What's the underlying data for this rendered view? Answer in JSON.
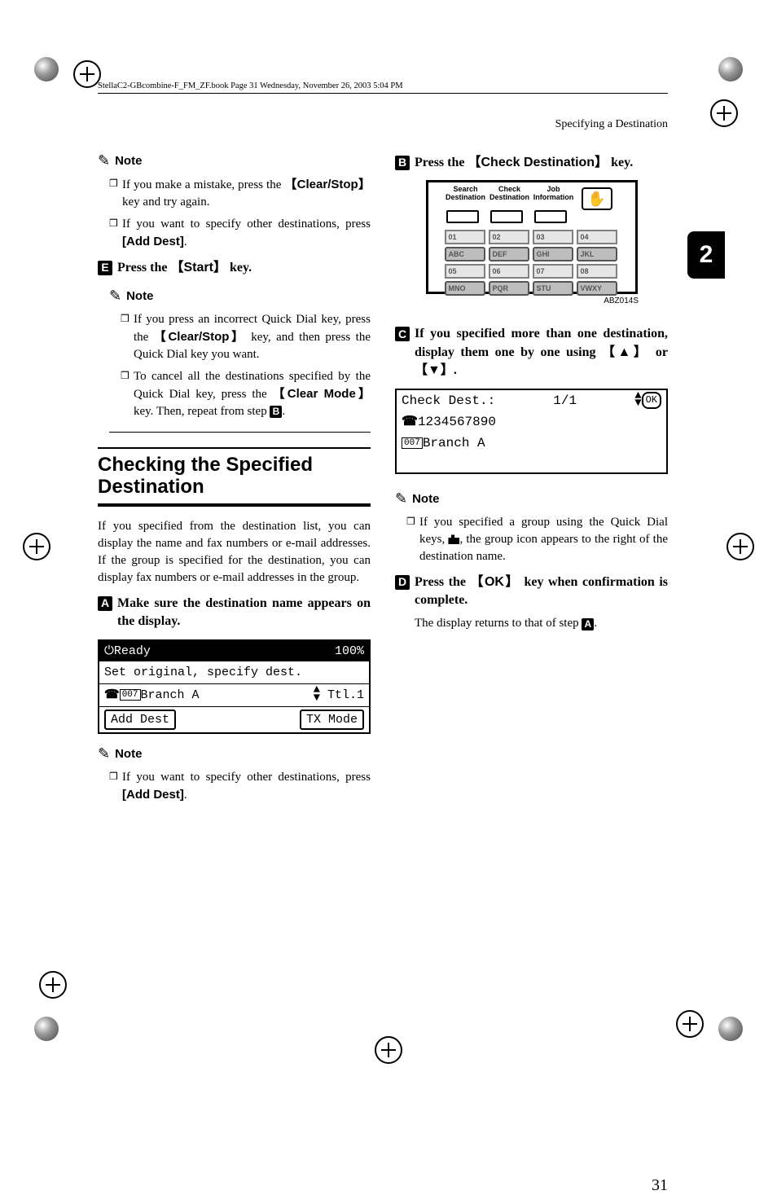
{
  "running_header": "StellaC2-GBcombine-F_FM_ZF.book  Page 31  Wednesday, November 26, 2003  5:04 PM",
  "section_header": "Specifying a Destination",
  "chapter_tab": "2",
  "page_number": "31",
  "left": {
    "note1_label": "Note",
    "note1_items": {
      "a_pre": "If you make a mistake, press the ",
      "a_key": "Clear/Stop",
      "a_post": " key and try again.",
      "b_pre": "If you want to specify other destinations, press ",
      "b_bold": "[Add Dest]",
      "b_post": "."
    },
    "stepE_num": "E",
    "stepE_pre": "Press the ",
    "stepE_key": "Start",
    "stepE_post": " key.",
    "note2_label": "Note",
    "note2_items": {
      "a_pre": "If you press an incorrect Quick Dial key, press the ",
      "a_key": "Clear/Stop",
      "a_post": " key, and then press the Quick Dial key you want.",
      "b_pre": "To cancel all the destinations specified by the Quick Dial key, press the ",
      "b_key": "Clear Mode",
      "b_post1": " key. Then, repeat from step ",
      "b_step": "B",
      "b_post2": "."
    },
    "heading": "Checking the Specified Destination",
    "intro": "If you specified from the destination list, you can display the name and fax numbers or e-mail addresses. If the group is specified for the destination, you can display fax numbers or e-mail addresses in the group.",
    "stepA_num": "A",
    "stepA_text": "Make sure the destination name appears on the display.",
    "lcd1": {
      "status_left": "Ready",
      "status_right": "100%",
      "line2": "Set original, specify dest.",
      "line3_code": "007",
      "line3_name": "Branch A",
      "line3_right": "Ttl.1",
      "btn_add": "Add Dest",
      "btn_tx": "TX Mode"
    },
    "note3_label": "Note",
    "note3_item_pre": "If you want to specify other destinations, press ",
    "note3_item_bold": "[Add Dest]",
    "note3_item_post": "."
  },
  "right": {
    "stepB_num": "B",
    "stepB_pre": "Press the ",
    "stepB_key": "Check Destination",
    "stepB_post": " key.",
    "panel": {
      "labels": [
        "Search Destination",
        "Check Destination",
        "Job Information"
      ],
      "row1": [
        "01",
        "02",
        "03",
        "04"
      ],
      "row_alpha": [
        "ABC",
        "DEF",
        "GHI",
        "JKL"
      ],
      "row2": [
        "05",
        "06",
        "07",
        "08"
      ],
      "row_alpha2": [
        "MNO",
        "PQR",
        "STU",
        "VWXY"
      ],
      "code": "ABZ014S"
    },
    "stepC_num": "C",
    "stepC_pre": "If you specified more than one destination, display them one by one using ",
    "stepC_mid": " or ",
    "stepC_post": ".",
    "lcd2": {
      "title": "Check Dest.:",
      "count": "1/1",
      "ok": "OK",
      "line2_num": "1234567890",
      "line3_code": "007",
      "line3_name": "Branch A"
    },
    "note4_label": "Note",
    "note4_item_pre": "If you specified a group using the Quick Dial keys, ",
    "note4_item_post": ", the group icon appears to the right of the destination name.",
    "stepD_num": "D",
    "stepD_pre": "Press the ",
    "stepD_key": "OK",
    "stepD_post": " key when confirmation is complete.",
    "stepD_follow_pre": "The display returns to that of step ",
    "stepD_follow_step": "A",
    "stepD_follow_post": "."
  }
}
